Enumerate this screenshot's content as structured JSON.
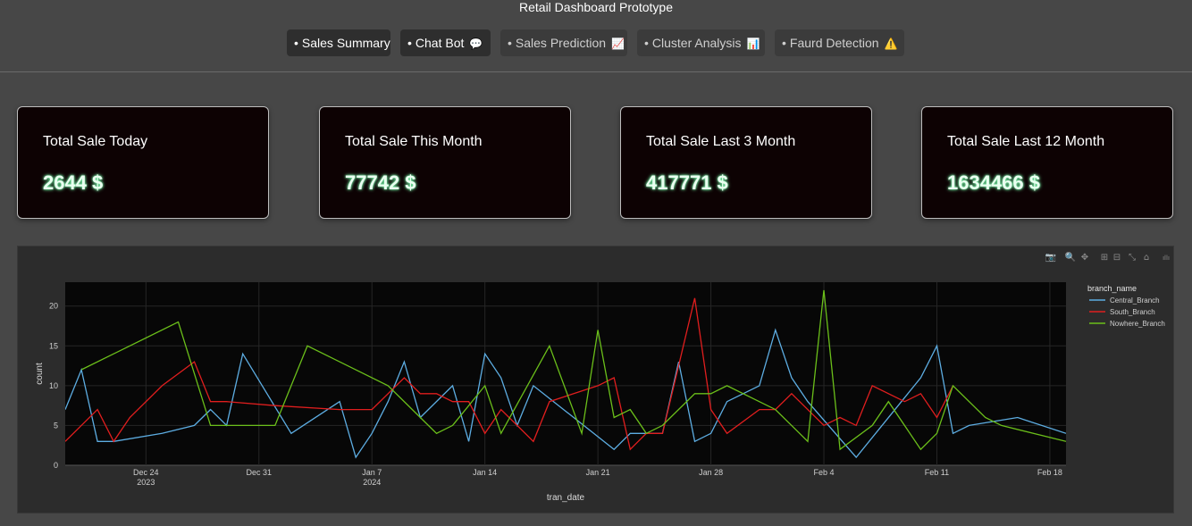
{
  "app": {
    "title": "Retail Dashboard Prototype"
  },
  "tabs": [
    {
      "label": "Sales Summary",
      "emoji": "",
      "active": true
    },
    {
      "label": "Chat Bot",
      "emoji": "💬",
      "active": true
    },
    {
      "label": "Sales Prediction",
      "emoji": "📈",
      "active": false
    },
    {
      "label": "Cluster Analysis",
      "emoji": "📊",
      "active": false
    },
    {
      "label": "Faurd Detection",
      "emoji": "⚠️",
      "active": false
    }
  ],
  "cards": [
    {
      "title": "Total Sale Today",
      "value": "2644 $"
    },
    {
      "title": "Total Sale This Month",
      "value": "77742 $"
    },
    {
      "title": "Total Sale Last 3 Month",
      "value": "417771 $"
    },
    {
      "title": "Total Sale Last 12 Month",
      "value": "1634466 $"
    }
  ],
  "toolbar": [
    {
      "name": "camera-icon",
      "glyph": "📷"
    },
    {
      "name": "zoom-icon",
      "glyph": "🔍"
    },
    {
      "name": "pan-icon",
      "glyph": "✥"
    },
    {
      "name": "zoom-in-icon",
      "glyph": "⊞"
    },
    {
      "name": "zoom-out-icon",
      "glyph": "⊟"
    },
    {
      "name": "autoscale-icon",
      "glyph": "⤡"
    },
    {
      "name": "reset-axes-icon",
      "glyph": "⌂"
    },
    {
      "name": "plotly-logo-icon",
      "glyph": "ıllı"
    }
  ],
  "chart_data": {
    "type": "line",
    "xlabel": "tran_date",
    "ylabel": "count",
    "legend_title": "branch_name",
    "legend_position": "right",
    "grid": true,
    "x_range": [
      "2023-12-19",
      "2024-02-19"
    ],
    "ylim": [
      0,
      23
    ],
    "y_ticks": [
      0,
      5,
      10,
      15,
      20
    ],
    "x_ticks": [
      {
        "date": "2023-12-24",
        "label": "Dec 24",
        "sublabel": "2023"
      },
      {
        "date": "2023-12-31",
        "label": "Dec 31",
        "sublabel": ""
      },
      {
        "date": "2024-01-07",
        "label": "Jan 7",
        "sublabel": "2024"
      },
      {
        "date": "2024-01-14",
        "label": "Jan 14",
        "sublabel": ""
      },
      {
        "date": "2024-01-21",
        "label": "Jan 21",
        "sublabel": ""
      },
      {
        "date": "2024-01-28",
        "label": "Jan 28",
        "sublabel": ""
      },
      {
        "date": "2024-02-04",
        "label": "Feb 4",
        "sublabel": ""
      },
      {
        "date": "2024-02-11",
        "label": "Feb 11",
        "sublabel": ""
      },
      {
        "date": "2024-02-18",
        "label": "Feb 18",
        "sublabel": ""
      }
    ],
    "series": [
      {
        "name": "Central_Branch",
        "color": "#5dade2",
        "points": [
          [
            "2023-12-19",
            7
          ],
          [
            "2023-12-20",
            12
          ],
          [
            "2023-12-21",
            3
          ],
          [
            "2023-12-22",
            3
          ],
          [
            "2023-12-25",
            4
          ],
          [
            "2023-12-27",
            5
          ],
          [
            "2023-12-28",
            7
          ],
          [
            "2023-12-29",
            5
          ],
          [
            "2023-12-30",
            14
          ],
          [
            "2024-01-02",
            4
          ],
          [
            "2024-01-05",
            8
          ],
          [
            "2024-01-06",
            1
          ],
          [
            "2024-01-07",
            4
          ],
          [
            "2024-01-08",
            8
          ],
          [
            "2024-01-09",
            13
          ],
          [
            "2024-01-10",
            6
          ],
          [
            "2024-01-12",
            10
          ],
          [
            "2024-01-13",
            3
          ],
          [
            "2024-01-14",
            14
          ],
          [
            "2024-01-15",
            11
          ],
          [
            "2024-01-16",
            5
          ],
          [
            "2024-01-17",
            10
          ],
          [
            "2024-01-22",
            2
          ],
          [
            "2024-01-23",
            4
          ],
          [
            "2024-01-24",
            4
          ],
          [
            "2024-01-25",
            4
          ],
          [
            "2024-01-26",
            13
          ],
          [
            "2024-01-27",
            3
          ],
          [
            "2024-01-28",
            4
          ],
          [
            "2024-01-29",
            8
          ],
          [
            "2024-01-31",
            10
          ],
          [
            "2024-02-01",
            17
          ],
          [
            "2024-02-02",
            11
          ],
          [
            "2024-02-03",
            8
          ],
          [
            "2024-02-06",
            1
          ],
          [
            "2024-02-10",
            11
          ],
          [
            "2024-02-11",
            15
          ],
          [
            "2024-02-12",
            4
          ],
          [
            "2024-02-13",
            5
          ],
          [
            "2024-02-16",
            6
          ],
          [
            "2024-02-19",
            4
          ]
        ]
      },
      {
        "name": "South_Branch",
        "color": "#e01e1e",
        "points": [
          [
            "2023-12-19",
            3
          ],
          [
            "2023-12-21",
            7
          ],
          [
            "2023-12-22",
            3
          ],
          [
            "2023-12-23",
            6
          ],
          [
            "2023-12-25",
            10
          ],
          [
            "2023-12-27",
            13
          ],
          [
            "2023-12-28",
            8
          ],
          [
            "2023-12-29",
            8
          ],
          [
            "2024-01-01",
            7.5
          ],
          [
            "2024-01-05",
            7
          ],
          [
            "2024-01-07",
            7
          ],
          [
            "2024-01-09",
            11
          ],
          [
            "2024-01-10",
            9
          ],
          [
            "2024-01-11",
            9
          ],
          [
            "2024-01-12",
            8
          ],
          [
            "2024-01-13",
            8
          ],
          [
            "2024-01-14",
            4
          ],
          [
            "2024-01-15",
            7
          ],
          [
            "2024-01-16",
            5
          ],
          [
            "2024-01-17",
            3
          ],
          [
            "2024-01-18",
            8
          ],
          [
            "2024-01-21",
            10
          ],
          [
            "2024-01-22",
            11
          ],
          [
            "2024-01-23",
            2
          ],
          [
            "2024-01-24",
            4
          ],
          [
            "2024-01-25",
            4
          ],
          [
            "2024-01-27",
            21
          ],
          [
            "2024-01-28",
            7
          ],
          [
            "2024-01-29",
            4
          ],
          [
            "2024-01-31",
            7
          ],
          [
            "2024-02-01",
            7
          ],
          [
            "2024-02-02",
            9
          ],
          [
            "2024-02-04",
            5
          ],
          [
            "2024-02-05",
            6
          ],
          [
            "2024-02-06",
            5
          ],
          [
            "2024-02-07",
            10
          ],
          [
            "2024-02-09",
            8
          ],
          [
            "2024-02-10",
            9
          ],
          [
            "2024-02-11",
            6
          ],
          [
            "2024-02-12",
            10
          ]
        ]
      },
      {
        "name": "Nowhere_Branch",
        "color": "#6bbf1a",
        "points": [
          [
            "2023-12-20",
            12
          ],
          [
            "2023-12-22",
            14
          ],
          [
            "2023-12-26",
            18
          ],
          [
            "2023-12-28",
            5
          ],
          [
            "2024-01-01",
            5
          ],
          [
            "2024-01-03",
            15
          ],
          [
            "2024-01-08",
            10
          ],
          [
            "2024-01-10",
            6
          ],
          [
            "2024-01-11",
            4
          ],
          [
            "2024-01-12",
            5
          ],
          [
            "2024-01-14",
            10
          ],
          [
            "2024-01-15",
            4
          ],
          [
            "2024-01-18",
            15
          ],
          [
            "2024-01-20",
            4
          ],
          [
            "2024-01-21",
            17
          ],
          [
            "2024-01-22",
            6
          ],
          [
            "2024-01-23",
            7
          ],
          [
            "2024-01-24",
            4
          ],
          [
            "2024-01-25",
            5
          ],
          [
            "2024-01-27",
            9
          ],
          [
            "2024-01-28",
            9
          ],
          [
            "2024-01-29",
            10
          ],
          [
            "2024-02-01",
            7
          ],
          [
            "2024-02-03",
            3
          ],
          [
            "2024-02-04",
            22
          ],
          [
            "2024-02-05",
            2
          ],
          [
            "2024-02-07",
            5
          ],
          [
            "2024-02-08",
            8
          ],
          [
            "2024-02-10",
            2
          ],
          [
            "2024-02-11",
            4
          ],
          [
            "2024-02-12",
            10
          ],
          [
            "2024-02-14",
            6
          ],
          [
            "2024-02-15",
            5
          ],
          [
            "2024-02-19",
            3
          ]
        ]
      }
    ]
  }
}
